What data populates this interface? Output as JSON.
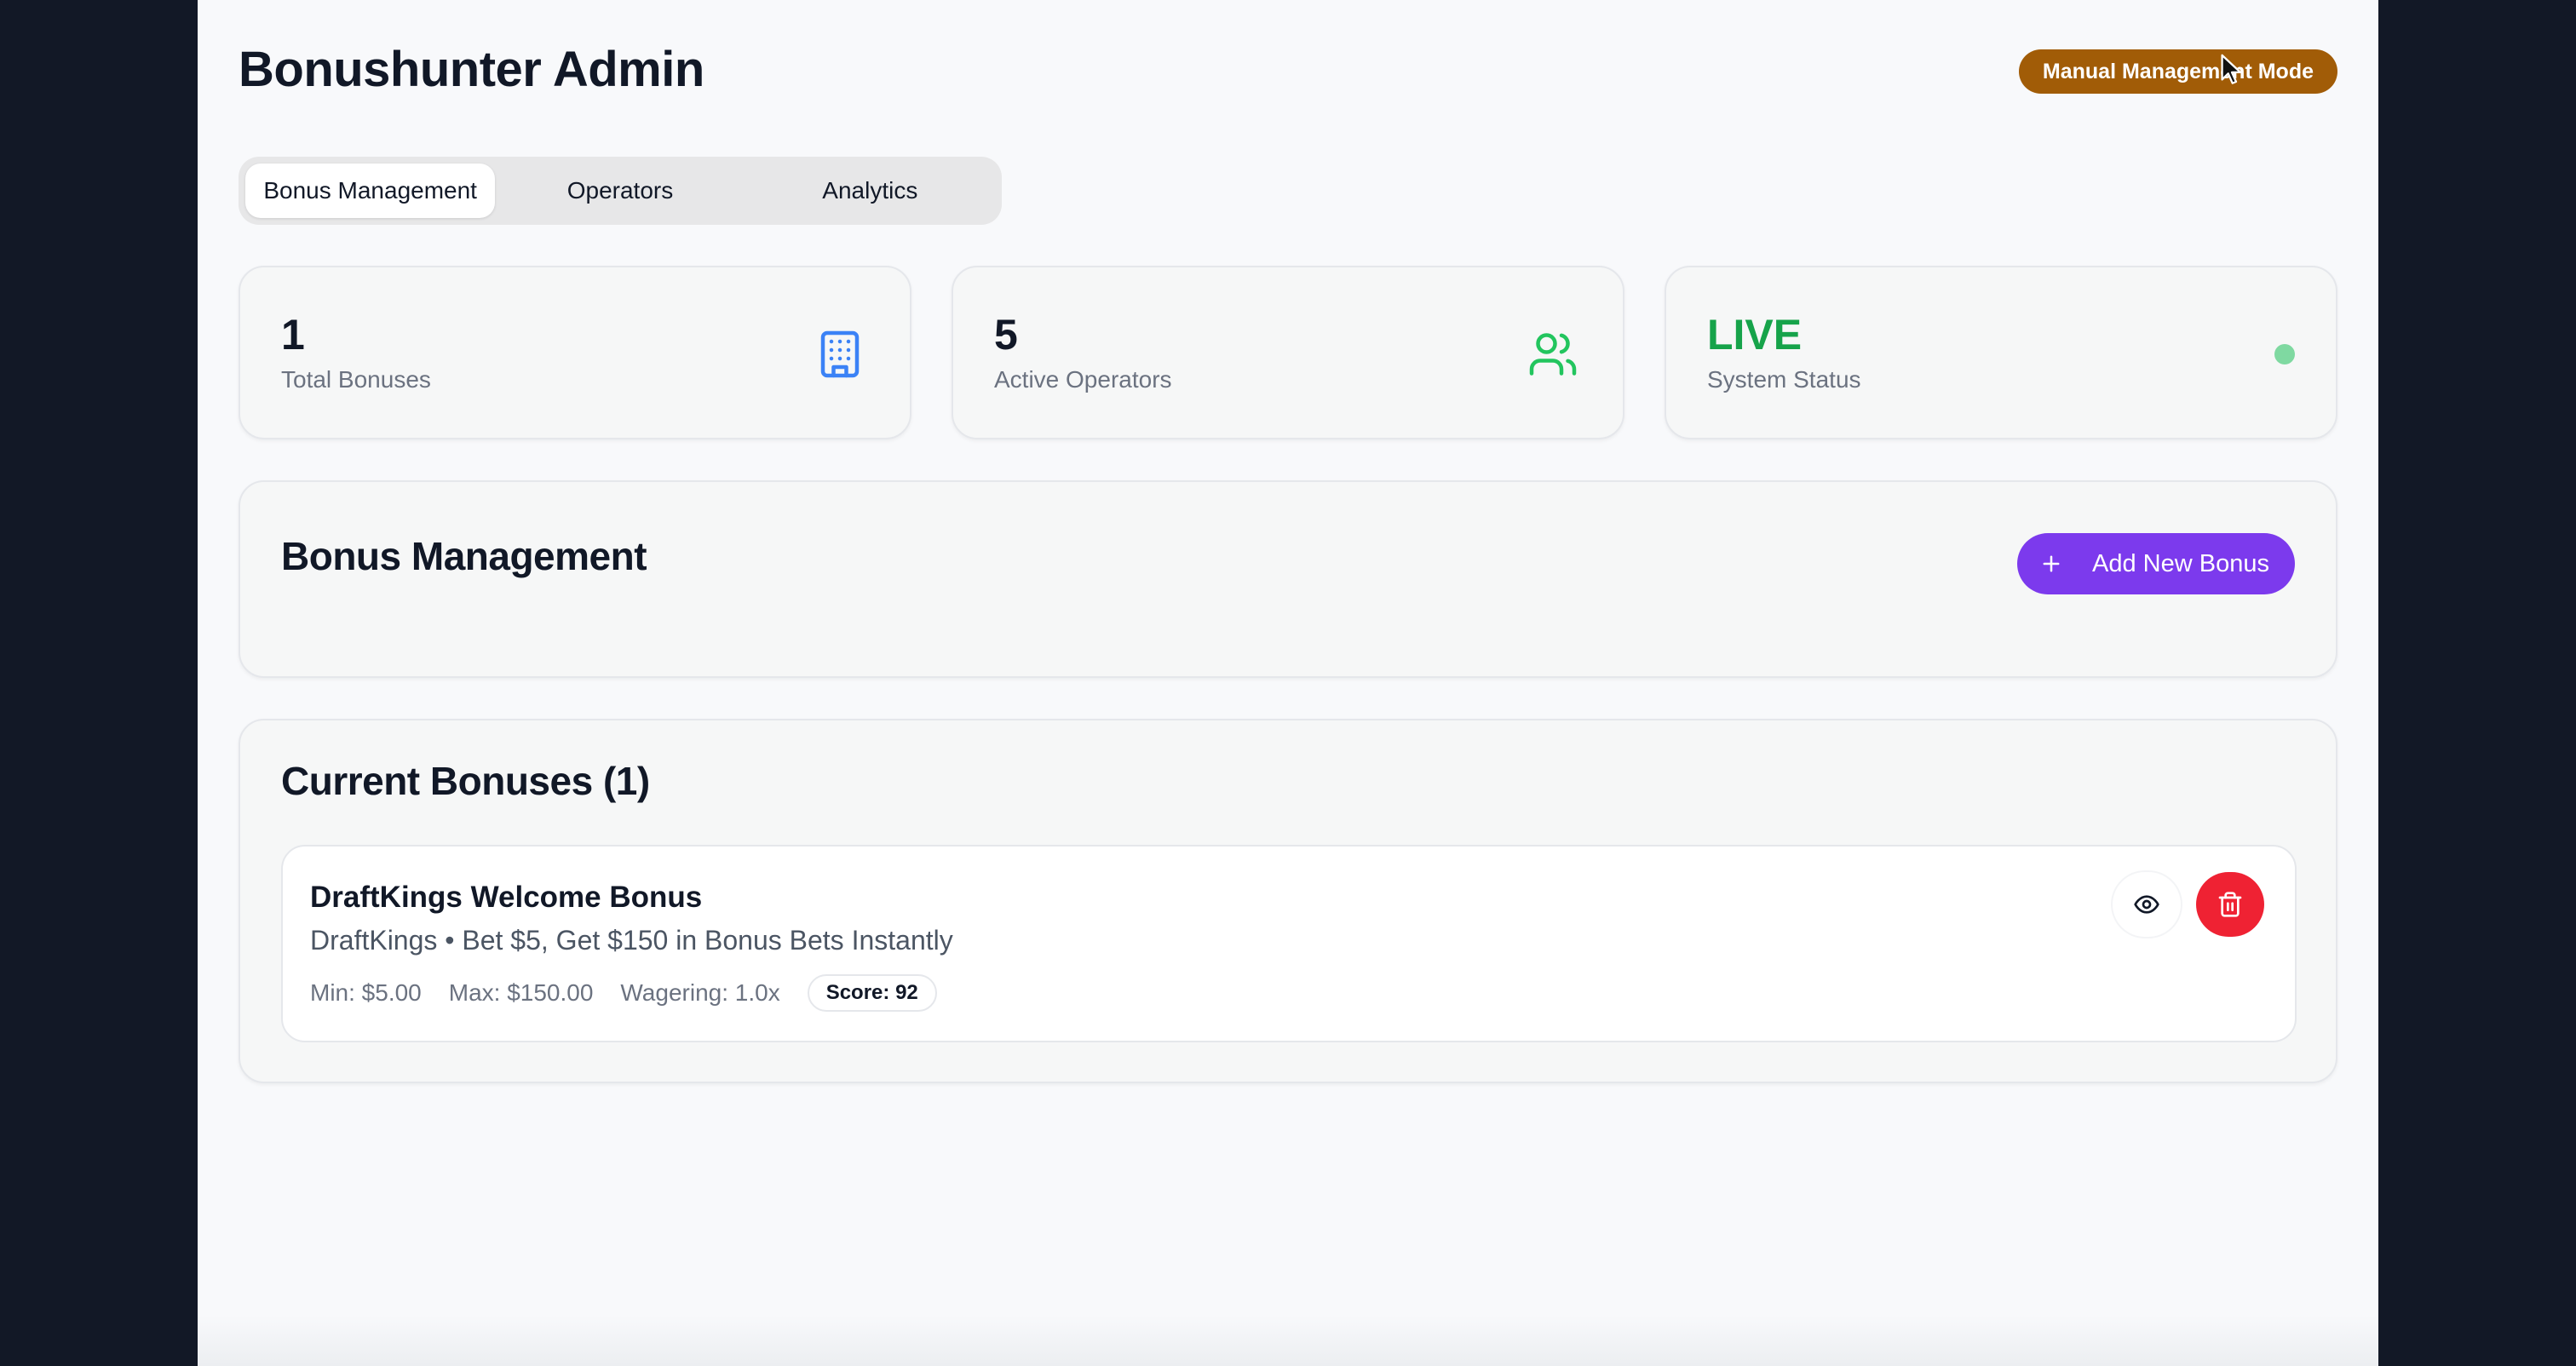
{
  "header": {
    "title": "Bonushunter Admin",
    "mode_badge": "Manual Management Mode"
  },
  "tabs": [
    {
      "label": "Bonus Management",
      "active": true
    },
    {
      "label": "Operators",
      "active": false
    },
    {
      "label": "Analytics",
      "active": false
    }
  ],
  "stats": [
    {
      "value": "1",
      "label": "Total Bonuses",
      "icon": "building-icon",
      "color": "#3b82f6"
    },
    {
      "value": "5",
      "label": "Active Operators",
      "icon": "users-icon",
      "color": "#22c55e"
    },
    {
      "value": "LIVE",
      "label": "System Status",
      "icon": "status-dot",
      "color": "#16a34a"
    }
  ],
  "management": {
    "title": "Bonus Management",
    "add_button_label": "Add New Bonus",
    "accent": "#7c3aed"
  },
  "current": {
    "title": "Current Bonuses (1)",
    "bonuses": [
      {
        "name": "DraftKings Welcome Bonus",
        "subtitle": "DraftKings • Bet $5, Get $150 in Bonus Bets Instantly",
        "min": "Min: $5.00",
        "max": "Max: $150.00",
        "wagering": "Wagering: 1.0x",
        "score": "Score: 92"
      }
    ]
  }
}
